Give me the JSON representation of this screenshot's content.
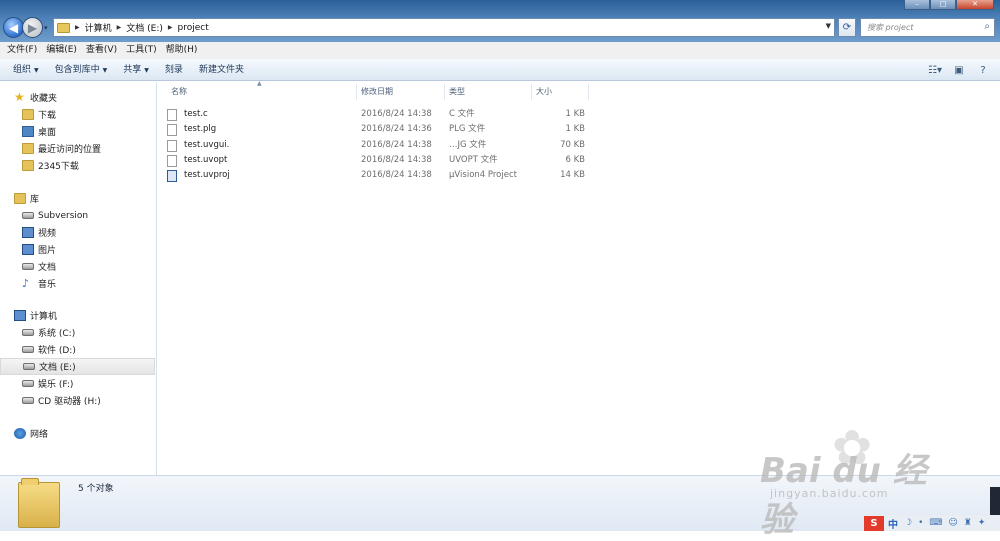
{
  "address": {
    "crumbs": [
      "计算机",
      "文档 (E:)",
      "project"
    ],
    "search_placeholder": "搜索 project"
  },
  "menu": [
    "文件(F)",
    "编辑(E)",
    "查看(V)",
    "工具(T)",
    "帮助(H)"
  ],
  "commands": {
    "organize": "组织",
    "include_library": "包含到库中",
    "share": "共享",
    "burn": "刻录",
    "new_folder": "新建文件夹"
  },
  "nav": {
    "favorites": "收藏夹",
    "favorites_items": [
      "下载",
      "桌面",
      "最近访问的位置",
      "2345下载"
    ],
    "libraries": "库",
    "library_items": [
      "Subversion",
      "视频",
      "图片",
      "文档",
      "音乐"
    ],
    "computer": "计算机",
    "drives": [
      "系统 (C:)",
      "软件 (D:)",
      "文档 (E:)",
      "娱乐 (F:)",
      "CD 驱动器 (H:)"
    ],
    "network": "网络"
  },
  "columns": {
    "name": "名称",
    "date": "修改日期",
    "type": "类型",
    "size": "大小"
  },
  "files": [
    {
      "name": "test.c",
      "date": "2016/8/24 14:38",
      "type": "C 文件",
      "size": "1 KB"
    },
    {
      "name": "test.plg",
      "date": "2016/8/24 14:36",
      "type": "PLG 文件",
      "size": "1 KB"
    },
    {
      "name": "test.uvgui.",
      "date": "2016/8/24 14:38",
      "type": "…JG 文件",
      "size": "70 KB"
    },
    {
      "name": "test.uvopt",
      "date": "2016/8/24 14:38",
      "type": "UVOPT 文件",
      "size": "6 KB"
    },
    {
      "name": "test.uvproj",
      "date": "2016/8/24 14:38",
      "type": "µVision4 Project",
      "size": "14 KB"
    }
  ],
  "status": {
    "count": "5 个对象"
  },
  "tray": {
    "badge": "S",
    "ime": "中"
  },
  "watermark": {
    "main": "Bai du 经验",
    "sub": "jingyan.baidu.com"
  }
}
